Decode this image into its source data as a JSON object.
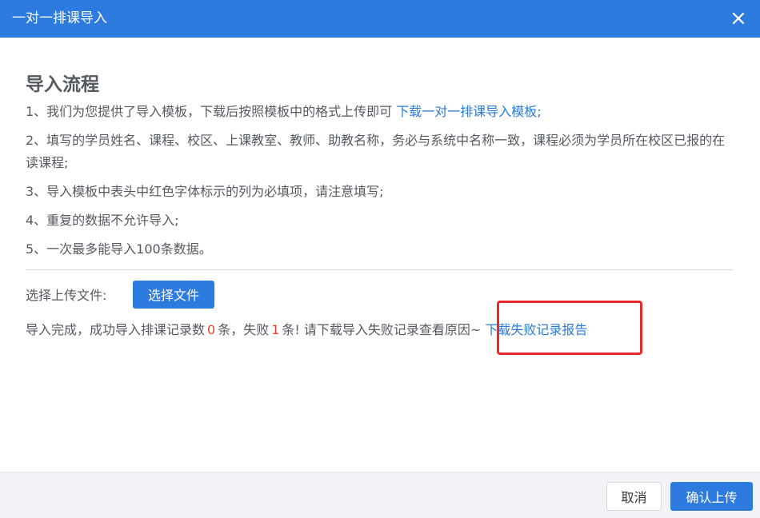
{
  "dialog": {
    "title": "一对一排课导入",
    "close_icon": "close-icon"
  },
  "guide": {
    "heading": "导入流程",
    "step1_text": "1、我们为您提供了导入模板，下载后按照模板中的格式上传即可 ",
    "step1_link": "下载一对一排课导入模板;",
    "step2_text": "2、填写的学员姓名、课程、校区、上课教室、教师、助教名称，务必与系统中名称一致，课程必须为学员所在校区已报的在读课程;",
    "step3_text": "3、导入模板中表头中红色字体标示的列为必填项，请注意填写;",
    "step4_text": "4、重复的数据不允许导入;",
    "step5_text": "5、一次最多能导入100条数据。"
  },
  "upload": {
    "label": "选择上传文件:",
    "button_label": "选择文件"
  },
  "result": {
    "prefix": "导入完成，成功导入排课记录数",
    "success_count": "0",
    "middle": "条，失败",
    "fail_count": "1",
    "suffix": "条! 请下载导入失败记录查看原因~ ",
    "link_label": "下载失败记录报告"
  },
  "footer": {
    "cancel_label": "取消",
    "confirm_label": "确认上传"
  },
  "colors": {
    "primary": "#2e7be0",
    "link": "#2b7bd8",
    "error_number": "#e0442f",
    "highlight": "#e8282d"
  }
}
